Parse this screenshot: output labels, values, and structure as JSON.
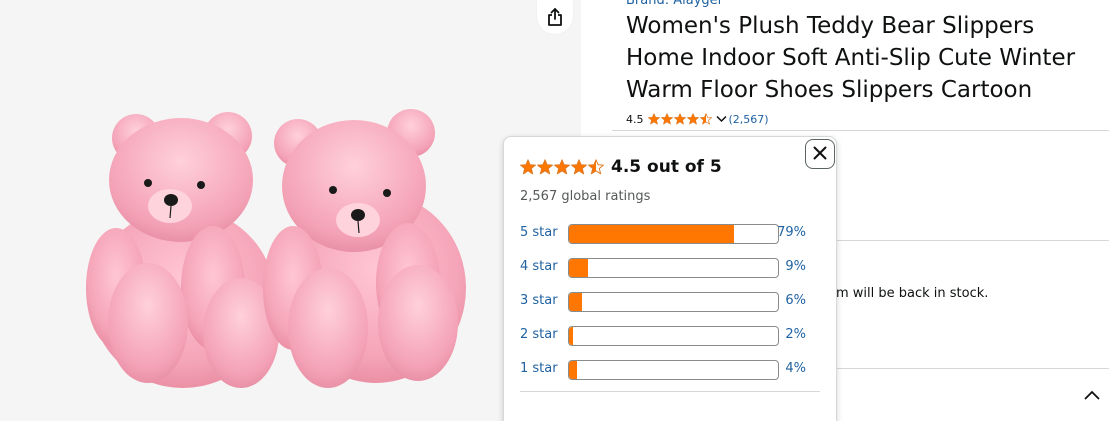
{
  "product": {
    "brand": "Brand: Alaygel",
    "title": "Women's Plush Teddy Bear Slippers Home Indoor Soft Anti-Slip Cute Winter Warm Floor Shoes Slippers Cartoon",
    "rating_value": "4.5",
    "rating_count": "(2,567)",
    "stars": 4.5,
    "image_icon": "pink-teddy-bear-slippers-image"
  },
  "share": {
    "icon": "share-icon"
  },
  "popover": {
    "out_of": "4.5 out of 5",
    "global_ratings": "2,567 global ratings",
    "close_icon": "close-icon",
    "histogram": [
      {
        "label": "5 star",
        "percent_text": "79%",
        "percent": 79
      },
      {
        "label": "4 star",
        "percent_text": "9%",
        "percent": 9
      },
      {
        "label": "3 star",
        "percent_text": "6%",
        "percent": 6
      },
      {
        "label": "2 star",
        "percent_text": "2%",
        "percent": 2
      },
      {
        "label": "1 star",
        "percent_text": "4%",
        "percent": 4
      }
    ]
  },
  "availability": {
    "text": "m will be back in stock."
  },
  "colors": {
    "star": "#ff7600",
    "link": "#2162a1",
    "bar_fill": "#ff7600"
  }
}
